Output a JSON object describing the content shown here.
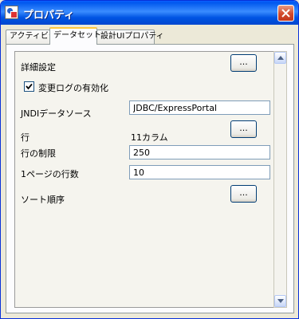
{
  "window": {
    "title": "プロパティ"
  },
  "tabs": [
    {
      "label": "アクティビティ"
    },
    {
      "label": "データセット"
    },
    {
      "label": "設計UIプロパティ"
    }
  ],
  "form": {
    "detail_settings": {
      "label": "詳細設定",
      "button_label": "..."
    },
    "change_log": {
      "label": "変更ログの有効化",
      "checked": true
    },
    "jndi": {
      "label": "JNDIデータソース",
      "value": "JDBC/ExpressPortal"
    },
    "rows": {
      "label": "行",
      "value": "11カラム",
      "button_label": "..."
    },
    "row_limit": {
      "label": "行の制限",
      "value": "250"
    },
    "rows_per_page": {
      "label": "1ページの行数",
      "value": "10"
    },
    "sort_order": {
      "label": "ソート順序",
      "button_label": "..."
    }
  }
}
